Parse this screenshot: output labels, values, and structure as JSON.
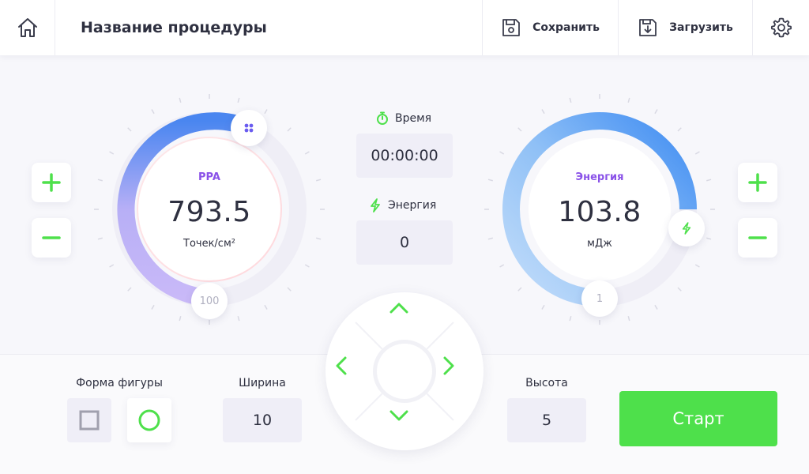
{
  "header": {
    "title": "Название процедуры",
    "save_label": "Сохранить",
    "load_label": "Загрузить",
    "icons": [
      "home-icon",
      "save-icon",
      "load-icon",
      "gear-icon"
    ]
  },
  "left_dial": {
    "label": "PPA",
    "value": "793.5",
    "unit": "Точек/см²",
    "knob_value": "100",
    "accent_color": "#8a52e8"
  },
  "right_dial": {
    "label": "Энергия",
    "value": "103.8",
    "unit": "мДж",
    "knob_value": "1",
    "accent_color": "#8a52e8"
  },
  "center_info": {
    "time_label": "Время",
    "time_value": "00:00:00",
    "energy_label": "Энергия",
    "energy_value": "0"
  },
  "bottom": {
    "shape_label": "Форма фигуры",
    "width_label": "Ширина",
    "width_value": "10",
    "height_label": "Высота",
    "height_value": "5",
    "start_label": "Старт",
    "selected_shape": "circle"
  },
  "colors": {
    "green": "#4ee04b",
    "purple": "#8a52e8",
    "blue": "#3f8cf2"
  }
}
